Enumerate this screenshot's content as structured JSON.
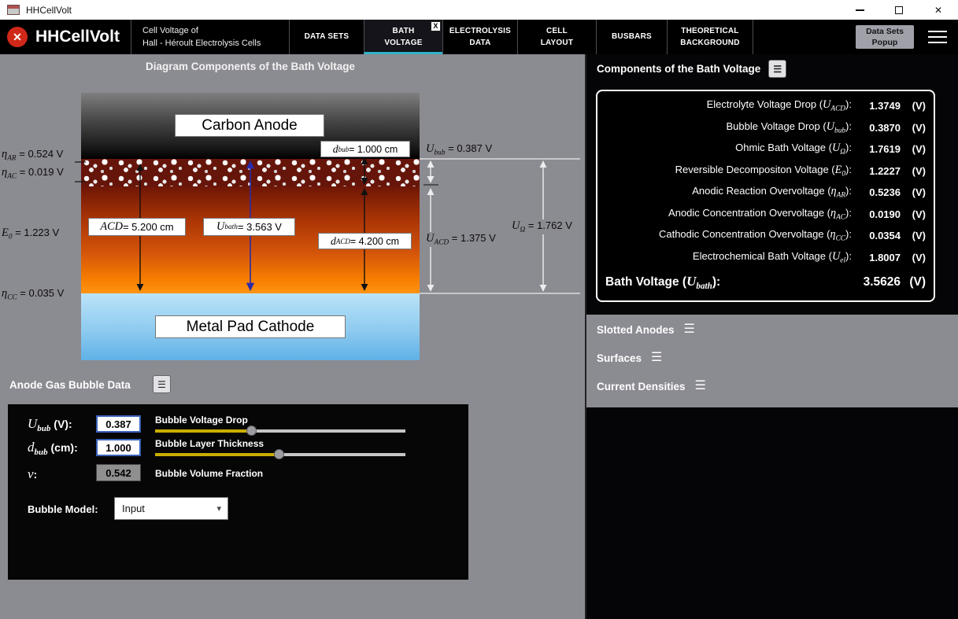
{
  "titlebar": {
    "title": "HHCellVolt"
  },
  "icons": {
    "close": "✕",
    "hamburger": "☰",
    "list": "☰",
    "chevron_down": "▾"
  },
  "colors": {
    "accent_teal": "#2fb3c7",
    "logo_red": "#d02818",
    "bath_orange": "#f57c00",
    "metal_blue": "#7ec2ee"
  },
  "header": {
    "app_name": "HHCellVolt",
    "logo_glyph": "✕",
    "subtitle_line1": "Cell Voltage of",
    "subtitle_line2": "Hall - Héroult Electrolysis Cells",
    "tab_close": "X",
    "tabs": [
      {
        "line1": "DATA SETS",
        "line2": ""
      },
      {
        "line1": "BATH",
        "line2": "VOLTAGE"
      },
      {
        "line1": "ELECTROLYSIS",
        "line2": "DATA"
      },
      {
        "line1": "CELL",
        "line2": "LAYOUT"
      },
      {
        "line1": "BUSBARS",
        "line2": ""
      },
      {
        "line1": "THEORETICAL",
        "line2": "BACKGROUND"
      }
    ],
    "popup_line1": "Data Sets",
    "popup_line2": "Popup"
  },
  "diagram": {
    "title": "Diagram Components of the Bath Voltage",
    "anode_label": "Carbon Anode",
    "cathode_label": "Metal Pad Cathode",
    "left_annotations": [
      {
        "sym": "η",
        "sub": "AR",
        "rest": " = 0.524 V"
      },
      {
        "sym": "η",
        "sub": "AC",
        "rest": " = 0.019 V"
      },
      {
        "sym": "E",
        "sub": "0",
        "rest": " = 1.223 V"
      },
      {
        "sym": "η",
        "sub": "CC",
        "rest": " = 0.035 V"
      }
    ],
    "boxes": {
      "dbub": {
        "sym": "d",
        "sub": "bub",
        "rest": " = 1.000 cm"
      },
      "acd": {
        "sym": "ACD",
        "sub": "",
        "rest": "  = 5.200 cm"
      },
      "ubath": {
        "sym": "U",
        "sub": "bath",
        "rest": " = 3.563 V"
      },
      "dacd": {
        "sym": "d",
        "sub": "ACD",
        "rest": " = 4.200 cm"
      }
    },
    "right_annotations": {
      "ubub": {
        "sym": "U",
        "sub": "bub",
        "rest": " = 0.387 V"
      },
      "uacd": {
        "sym": "U",
        "sub": "ACD",
        "rest": " = 1.375 V"
      },
      "uomega": {
        "sym": "U",
        "sub": "Ω",
        "rest": " = 1.762 V"
      }
    }
  },
  "bubble": {
    "section_title": "Anode Gas Bubble Data",
    "rows": [
      {
        "sym": "U",
        "sub": "bub",
        "unit": " (V):",
        "value": "0.387",
        "label": "Bubble Voltage Drop"
      },
      {
        "sym": "d",
        "sub": "bub",
        "unit": " (cm):",
        "value": "1.000",
        "label": "Bubble Layer Thickness"
      },
      {
        "sym": "v",
        "sub": "",
        "unit": ":",
        "value": "0.542",
        "label": "Bubble Volume Fraction"
      }
    ],
    "model_label": "Bubble Model:",
    "model_value": "Input"
  },
  "results": {
    "title": "Components of the Bath Voltage",
    "rows": [
      {
        "pre": "Electrolyte Voltage Drop (",
        "sym": "U",
        "sub": "ACD",
        "post": "):",
        "value": "1.3749",
        "unit": "(V)"
      },
      {
        "pre": "Bubble Voltage Drop (",
        "sym": "U",
        "sub": "bub",
        "post": "):",
        "value": "0.3870",
        "unit": "(V)"
      },
      {
        "pre": "Ohmic Bath Voltage (",
        "sym": "U",
        "sub": "Ω",
        "post": "):",
        "value": "1.7619",
        "unit": "(V)"
      },
      {
        "pre": "Reversible Decompositon Voltage (",
        "sym": "E",
        "sub": "0",
        "post": "):",
        "value": "1.2227",
        "unit": "(V)"
      },
      {
        "pre": "Anodic Reaction Overvoltage (",
        "sym": "η",
        "sub": "AR",
        "post": "):",
        "value": "0.5236",
        "unit": "(V)"
      },
      {
        "pre": "Anodic Concentration Overvoltage (",
        "sym": "η",
        "sub": "AC",
        "post": "):",
        "value": "0.0190",
        "unit": "(V)"
      },
      {
        "pre": "Cathodic Concentration Overvoltage (",
        "sym": "η",
        "sub": "CC",
        "post": "):",
        "value": "0.0354",
        "unit": "(V)"
      },
      {
        "pre": "Electrochemical Bath Voltage (",
        "sym": "U",
        "sub": "el",
        "post": "):",
        "value": "1.8007",
        "unit": "(V)"
      },
      {
        "pre": "Bath Voltage (",
        "sym": "U",
        "sub": "bath",
        "post": "):",
        "value": "3.5626",
        "unit": "(V)"
      }
    ],
    "menus": [
      "Slotted Anodes",
      "Surfaces",
      "Current Densities"
    ]
  }
}
